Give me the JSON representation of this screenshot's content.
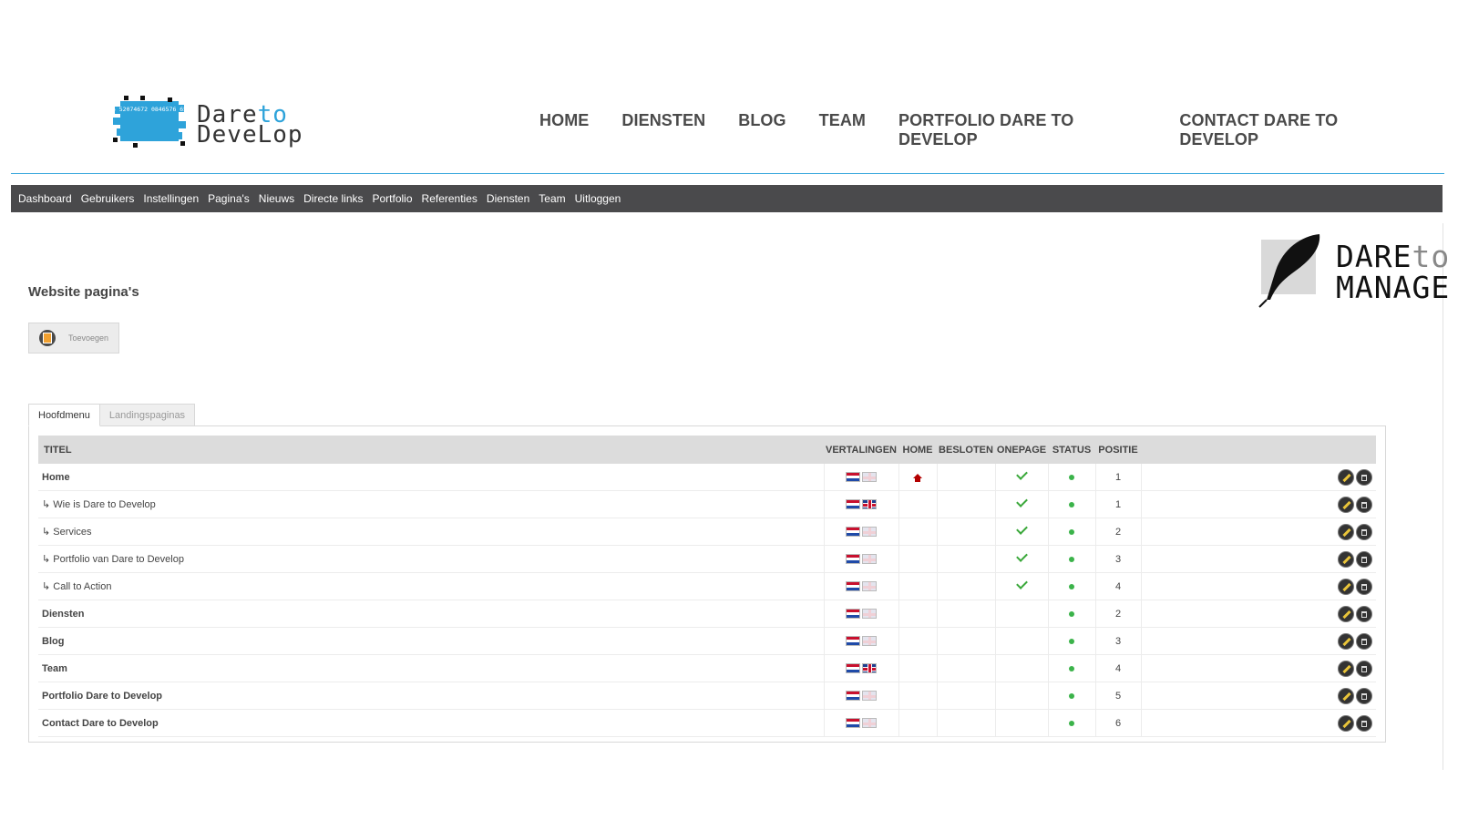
{
  "brand": {
    "logo_mark_text": "6461726 52074672 0846576 656C6F70",
    "word_part1": "Dare",
    "word_part2": "to",
    "word_line2": "DeveLop"
  },
  "main_nav": [
    "HOME",
    "DIENSTEN",
    "BLOG",
    "TEAM",
    "PORTFOLIO DARE TO DEVELOP",
    "CONTACT DARE TO DEVELOP"
  ],
  "admin_nav": [
    "Dashboard",
    "Gebruikers",
    "Instellingen",
    "Pagina's",
    "Nieuws",
    "Directe links",
    "Portfolio",
    "Referenties",
    "Diensten",
    "Team",
    "Uitloggen"
  ],
  "manage_logo": {
    "line1_main": "DARE",
    "line1_accent": "to",
    "line2": "MANAGE"
  },
  "page_heading": "Website pagina's",
  "add_button_label": "Toevoegen",
  "tabs": [
    {
      "label": "Hoofdmenu",
      "active": true
    },
    {
      "label": "Landingspaginas",
      "active": false
    }
  ],
  "table": {
    "headers": {
      "title": "TITEL",
      "translations": "VERTALINGEN",
      "home": "HOME",
      "closed": "BESLOTEN",
      "onepage": "ONEPAGE",
      "status": "STATUS",
      "position": "POSITIE"
    },
    "rows": [
      {
        "title": "Home",
        "sub": false,
        "en": false,
        "home": true,
        "onepage": true,
        "position": "1"
      },
      {
        "title": "↳ Wie is Dare to Develop",
        "sub": true,
        "en": true,
        "home": false,
        "onepage": true,
        "position": "1"
      },
      {
        "title": "↳ Services",
        "sub": true,
        "en": false,
        "home": false,
        "onepage": true,
        "position": "2"
      },
      {
        "title": "↳ Portfolio van Dare to Develop",
        "sub": true,
        "en": false,
        "home": false,
        "onepage": true,
        "position": "3"
      },
      {
        "title": "↳ Call to Action",
        "sub": true,
        "en": false,
        "home": false,
        "onepage": true,
        "position": "4"
      },
      {
        "title": "Diensten",
        "sub": false,
        "en": false,
        "home": false,
        "onepage": false,
        "position": "2"
      },
      {
        "title": "Blog",
        "sub": false,
        "en": false,
        "home": false,
        "onepage": false,
        "position": "3"
      },
      {
        "title": "Team",
        "sub": false,
        "en": true,
        "home": false,
        "onepage": false,
        "position": "4"
      },
      {
        "title": "Portfolio Dare to Develop",
        "sub": false,
        "en": false,
        "home": false,
        "onepage": false,
        "position": "5"
      },
      {
        "title": "Contact Dare to Develop",
        "sub": false,
        "en": false,
        "home": false,
        "onepage": false,
        "position": "6"
      }
    ]
  },
  "icons": {
    "add": "add-page-icon",
    "edit": "pencil-icon",
    "delete": "trash-icon",
    "home": "home-icon",
    "onepage": "checkmark-icon",
    "status": "status-dot-icon"
  },
  "colors": {
    "accent": "#2ea3da",
    "admin_bar": "#4a4a4c",
    "status_active": "#3bb34a",
    "check": "#3aa83a",
    "home_icon": "#b30000"
  }
}
